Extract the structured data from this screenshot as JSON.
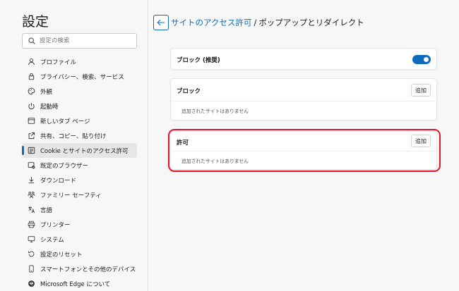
{
  "sidebar": {
    "title": "設定",
    "search_placeholder": "設定の検索",
    "items": [
      {
        "label": "プロファイル",
        "icon": "profile-icon"
      },
      {
        "label": "プライバシー、検索、サービス",
        "icon": "lock-icon"
      },
      {
        "label": "外観",
        "icon": "palette-icon"
      },
      {
        "label": "起動時",
        "icon": "power-icon"
      },
      {
        "label": "新しいタブ ページ",
        "icon": "new-tab-icon"
      },
      {
        "label": "共有、コピー、貼り付け",
        "icon": "share-icon"
      },
      {
        "label": "Cookie とサイトのアクセス許可",
        "icon": "site-permissions-icon",
        "active": true
      },
      {
        "label": "既定のブラウザー",
        "icon": "default-browser-icon"
      },
      {
        "label": "ダウンロード",
        "icon": "download-icon"
      },
      {
        "label": "ファミリー セーフティ",
        "icon": "family-icon"
      },
      {
        "label": "言語",
        "icon": "language-icon"
      },
      {
        "label": "プリンター",
        "icon": "printer-icon"
      },
      {
        "label": "システム",
        "icon": "system-icon"
      },
      {
        "label": "設定のリセット",
        "icon": "reset-icon"
      },
      {
        "label": "スマートフォンとその他のデバイス",
        "icon": "phone-icon"
      },
      {
        "label": "Microsoft Edge について",
        "icon": "edge-icon"
      }
    ]
  },
  "header": {
    "parent": "サイトのアクセス許可",
    "separator": "/",
    "current": "ポップアップとリダイレクト"
  },
  "block_recommended": {
    "label": "ブロック (推奨)",
    "enabled": true
  },
  "block_section": {
    "title": "ブロック",
    "add_label": "追加",
    "empty_text": "追加されたサイトはありません"
  },
  "allow_section": {
    "title": "許可",
    "add_label": "追加",
    "empty_text": "追加されたサイトはありません"
  },
  "colors": {
    "accent": "#0f6cbd",
    "highlight": "#e0142c"
  }
}
